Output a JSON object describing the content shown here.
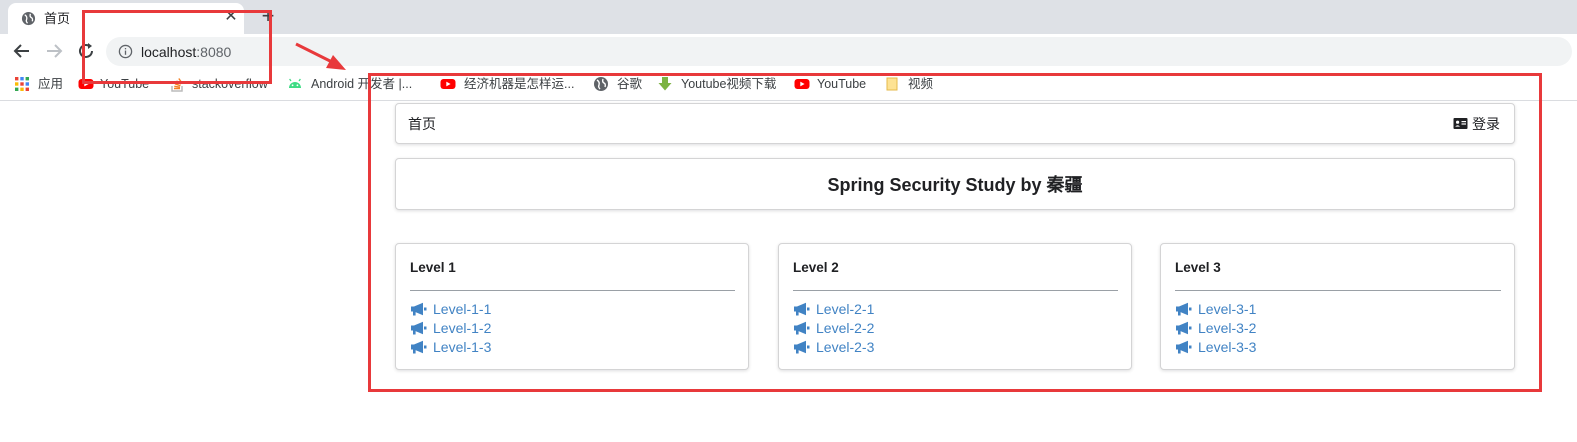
{
  "browser": {
    "tab": {
      "title": "首页",
      "favicon": "globe-icon",
      "close_glyph": "✕"
    },
    "new_tab_glyph": "+",
    "nav": {
      "back": "back-arrow-icon",
      "forward": "forward-arrow-icon",
      "reload": "reload-icon"
    },
    "address": {
      "host": "localhost",
      "port": ":8080",
      "icon": "info-icon"
    }
  },
  "bookmarks": [
    {
      "label": "应用",
      "icon": "apps-grid-icon"
    },
    {
      "label": "YouTube",
      "icon": "youtube-icon"
    },
    {
      "label": "stackoverflow",
      "icon": "stackoverflow-icon"
    },
    {
      "label": "Android 开发者 |...",
      "icon": "android-icon"
    },
    {
      "label": "经济机器是怎样运...",
      "icon": "youtube-icon"
    },
    {
      "label": "谷歌",
      "icon": "globe-icon"
    },
    {
      "label": "Youtube视频下载",
      "icon": "download-icon"
    },
    {
      "label": "YouTube",
      "icon": "youtube-icon"
    },
    {
      "label": "视频",
      "icon": "folder-icon"
    }
  ],
  "page": {
    "menu": {
      "home": "首页",
      "login": "登录",
      "login_icon": "id-card-icon"
    },
    "heading": "Spring Security Study by 秦疆",
    "levels": [
      {
        "title": "Level 1",
        "links": [
          "Level-1-1",
          "Level-1-2",
          "Level-1-3"
        ]
      },
      {
        "title": "Level 2",
        "links": [
          "Level-2-1",
          "Level-2-2",
          "Level-2-3"
        ]
      },
      {
        "title": "Level 3",
        "links": [
          "Level-3-1",
          "Level-3-2",
          "Level-3-3"
        ]
      }
    ],
    "link_icon": "bullhorn-icon"
  },
  "colors": {
    "link": "#4183c4",
    "annotation": "#e8393b",
    "youtube": "#ff0000",
    "android": "#3ddc84"
  }
}
